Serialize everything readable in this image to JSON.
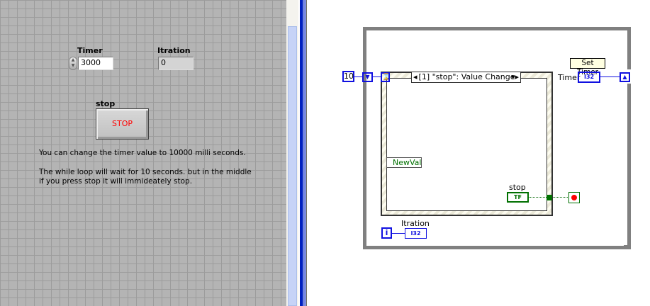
{
  "front_panel": {
    "timer": {
      "label": "Timer",
      "value": "3000"
    },
    "iteration": {
      "label": "Itration",
      "value": "0"
    },
    "stop": {
      "label": "stop",
      "button_text": "STOP"
    },
    "note1": "You can change the timer value to 10000 milli seconds.",
    "note2": "The while loop will wait for 10 seconds. but in the middle",
    "note3": "if you press stop it will immideately stop."
  },
  "block_diagram": {
    "constant": "10",
    "event_case": "[1] \"stop\": Value Change",
    "newval": "NewVal",
    "stop_label": "stop",
    "stop_terminal": "TF",
    "timer_label": "Timer",
    "timer_terminal": "I32",
    "tooltip": "Set Timer",
    "iteration_label": "Itration",
    "iteration_terminal": "I32",
    "loop_index": "i"
  },
  "colors": {
    "numeric_wire": "#1010e0",
    "boolean_wire": "#006600",
    "stop_red": "#ff0000"
  }
}
